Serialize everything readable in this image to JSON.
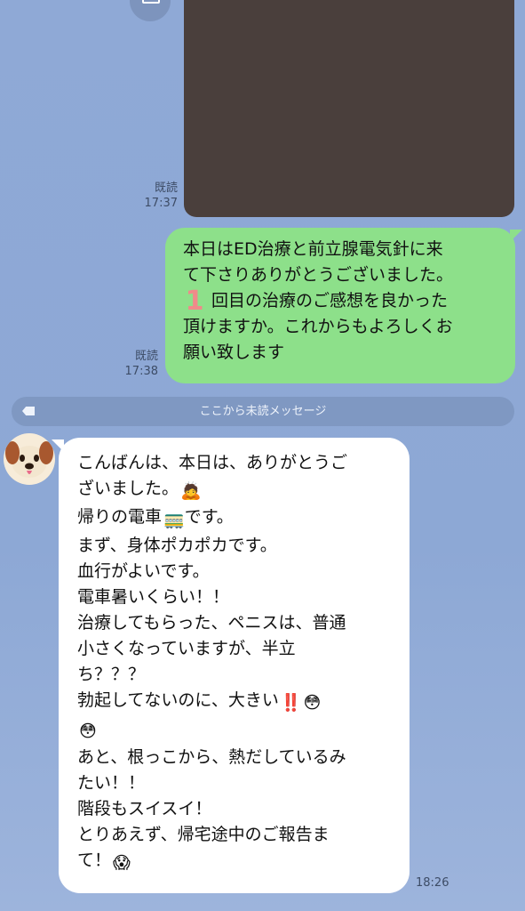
{
  "top_button": {
    "icon": "square-icon"
  },
  "photo": {
    "placeholder": "Image omitted"
  },
  "photo_meta": {
    "read": "既読",
    "time": "17:37"
  },
  "outgoing": {
    "read": "既読",
    "time": "17:38",
    "lines": [
      "本日はED治療と前立腺電気針に来",
      "て下さりありがとうございました。",
      "回目の治療のご感想を良かった",
      "頂けますか。これからもよろしくお",
      "願い致します"
    ],
    "number_emoji": "1",
    "colors": {
      "bubble": "#8de08a",
      "number": "#f08a8a"
    }
  },
  "divider": {
    "label": "ここから未読メッセージ",
    "icon": "tag-icon"
  },
  "incoming": {
    "avatar": "dog-face-icon",
    "time": "18:26",
    "lines": [
      "こんばんは、本日は、ありがとうご",
      "ざいました。",
      "帰りの電車",
      "まず、身体ポカポカです。",
      "血行がよいです。",
      "電車暑いくらい！！",
      "治療してもらった、ペニスは、普通",
      "小さくなっていますが、半立",
      "ち？？？",
      "勃起してないのに、大きい",
      "",
      "あと、根っこから、熱だしているみ",
      "たい！！",
      "階段もスイスイ！",
      "とりあえず、帰宅途中のご報告ま",
      "て！"
    ],
    "emoji": {
      "bow": "🙇",
      "tram": "🚃",
      "tram_suffix": "です。",
      "double_exclamation": "‼️",
      "flushed": "😳",
      "scream": "😱"
    }
  }
}
